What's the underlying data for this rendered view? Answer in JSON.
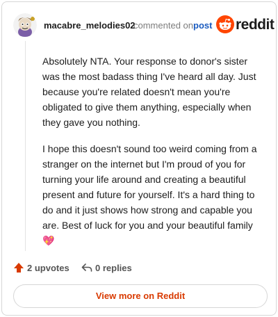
{
  "comment": {
    "author": "macabre_melodies02",
    "action_text": "commented on",
    "post_link": "post",
    "paragraphs": [
      "Absolutely NTA. Your response to donor's sister was the most badass thing I've heard all day. Just because you're related doesn't mean you're obligated to give them anything, especially when they gave you nothing.",
      "I hope this doesn't sound too weird coming from a stranger on the internet but I'm proud of you for turning your life around and creating a beautiful present and future for yourself. It's a hard thing to do and it just shows how strong and capable you are. Best of luck for you and your beautiful family"
    ],
    "emoji": "💖",
    "upvotes": "2 upvotes",
    "replies": "0 replies"
  },
  "brand": {
    "logo_text": "reddit",
    "accent": "#ff4500"
  },
  "footer": {
    "view_more_label": "View more on Reddit",
    "link_color": "#d93a00"
  },
  "icons": {
    "avatar": "snoo-avatar-icon",
    "logo": "reddit-logo-icon",
    "upvote": "upvote-arrow-icon",
    "reply": "reply-arrow-icon"
  }
}
